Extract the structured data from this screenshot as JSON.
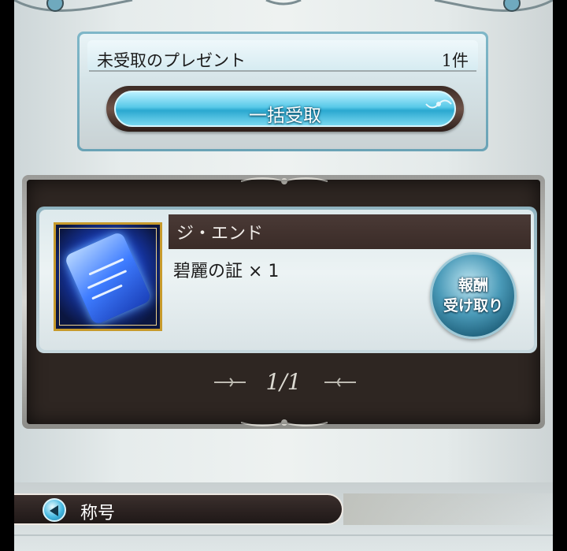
{
  "summary": {
    "title": "未受取のプレゼント",
    "count": "1件",
    "bulk_button_label": "一括受取"
  },
  "list": {
    "items": [
      {
        "name": "ジ・エンド",
        "detail": "碧麗の証 × 1",
        "icon": "blue-scroll-icon",
        "claim_line1": "報酬",
        "claim_line2": "受け取り"
      }
    ],
    "pager": "1/1"
  },
  "bottom_bar": {
    "label": "称号",
    "icon": "back-arrow-icon"
  },
  "colors": {
    "accent_cyan": "#58c9e8",
    "frame_dark": "#2e2622",
    "panel_light": "#e6ecec",
    "gold_border": "#c79a2c"
  }
}
